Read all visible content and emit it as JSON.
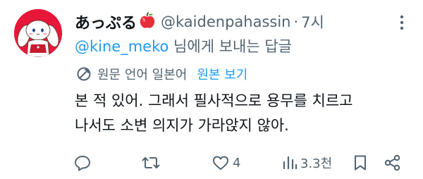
{
  "tweet": {
    "display_name": "あっぷる",
    "name_emoji": "apple-emoji",
    "handle": "@kaidenpahassin",
    "dot": "·",
    "time": "7시",
    "reply_to": "@kine_meko",
    "reply_suffix": " 님에게 보내는 답글",
    "translation": {
      "original_language_label": "원문 언어 일본어",
      "show_original_label": "원본 보기"
    },
    "body_lines": [
      "본 적 있어. 그래서 필사적으로 용무를 치르고",
      "나서도 소변 의지가 가라앉지 않아."
    ],
    "actions": {
      "reply_icon": "reply-icon",
      "retweet_icon": "retweet-icon",
      "like_icon": "heart-icon",
      "like_count": "4",
      "views_icon": "views-icon",
      "view_count": "3.3천",
      "bookmark_icon": "bookmark-icon",
      "share_icon": "share-icon"
    }
  },
  "colors": {
    "accent": "#1d9bf0",
    "secondary_text": "#536471",
    "primary_text": "#0f1419",
    "avatar_background": "#e8173a"
  }
}
